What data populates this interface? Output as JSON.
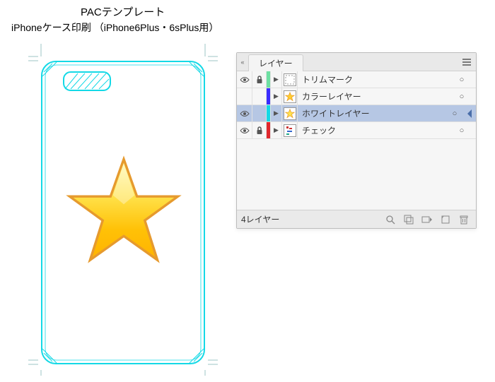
{
  "header": {
    "title": "PACテンプレート",
    "subtitle": "iPhoneケース印刷  （iPhone6Plus・6sPlus用）"
  },
  "panel": {
    "tab_label": "レイヤー",
    "status": "4レイヤー",
    "layers": [
      {
        "name": "トリムマーク",
        "visible": true,
        "locked": true,
        "color": "#6de0a2",
        "selected": false,
        "show_eye": true,
        "show_lock": true
      },
      {
        "name": "カラーレイヤー",
        "visible": true,
        "locked": false,
        "color": "#3a2cff",
        "selected": false,
        "show_eye": false,
        "show_lock": false
      },
      {
        "name": "ホワイトレイヤー",
        "visible": true,
        "locked": false,
        "color": "#14d9e6",
        "selected": true,
        "show_eye": true,
        "show_lock": false
      },
      {
        "name": "チェック",
        "visible": true,
        "locked": true,
        "color": "#e0272d",
        "selected": false,
        "show_eye": true,
        "show_lock": true
      }
    ]
  }
}
